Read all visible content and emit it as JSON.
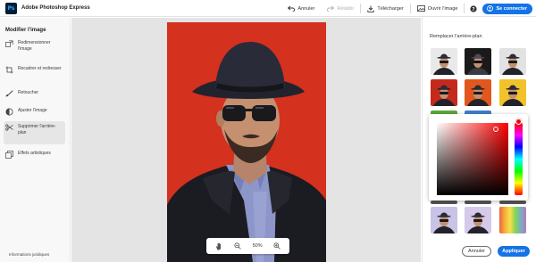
{
  "app": {
    "logo_text": "Ps",
    "title": "Adobe Photoshop Express"
  },
  "toolbar": {
    "undo_label": "Annuler",
    "redo_label": "Rétablir",
    "download_label": "Télécharger",
    "open_label": "Ouvrir l'image",
    "signin_label": "Se connecter"
  },
  "sidebar": {
    "title": "Modifier l'image",
    "items": [
      {
        "label": "Redimensionner l'image",
        "icon": "resize-icon"
      },
      {
        "label": "Recadrer et redresser",
        "icon": "crop-icon"
      },
      {
        "label": "Retoucher",
        "icon": "brush-icon"
      },
      {
        "label": "Ajuster l'image",
        "icon": "adjust-icon"
      },
      {
        "label": "Supprimer l'arrière-plan",
        "icon": "scissors-icon",
        "active": true
      },
      {
        "label": "Effets artistiques",
        "icon": "effects-icon"
      }
    ],
    "legal": "Informations juridiques"
  },
  "zoom": {
    "value": "50%"
  },
  "panel": {
    "title": "Remplacer l'arrière-plan",
    "thumb_colors": [
      "#e9e9e9",
      "#1a1a1a",
      "#e2e2e2",
      "#c42a1c",
      "#e2571d",
      "#f2c22a",
      "#c9c3e6",
      "#d6c9ea",
      "#e9cc6a"
    ],
    "selected_color": "#ff0000",
    "cancel_label": "Annuler",
    "apply_label": "Appliquer"
  },
  "colors": {
    "accent": "#1473e6",
    "photo_bg": "#d4311f"
  }
}
